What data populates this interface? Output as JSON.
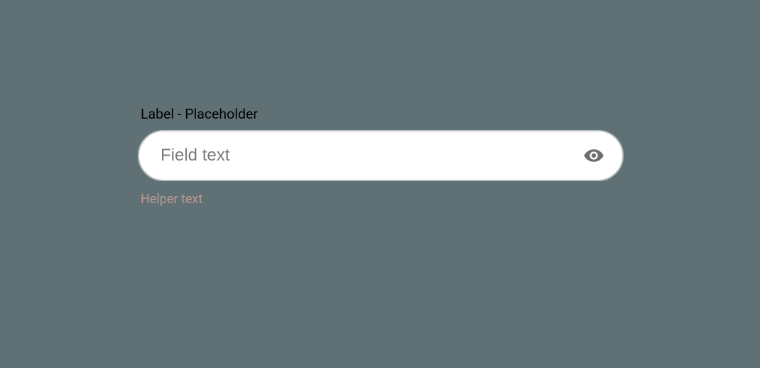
{
  "field": {
    "label": "Label - Placeholder",
    "placeholder": "Field text",
    "value": "",
    "helper": "Helper text"
  }
}
